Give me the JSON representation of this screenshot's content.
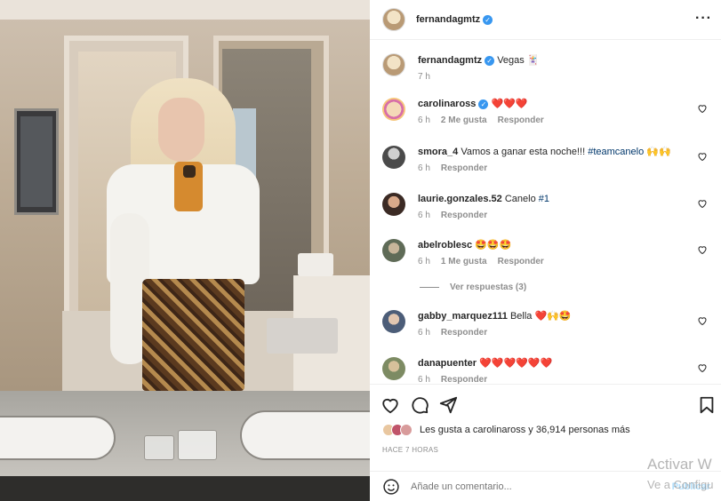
{
  "post": {
    "author": "fernandagmtz",
    "caption_user": "fernandagmtz",
    "caption_text": "Vegas 🃏",
    "caption_time": "7 h"
  },
  "comments": [
    {
      "user": "carolinaross",
      "verified": true,
      "text": "❤️❤️❤️",
      "time": "6 h",
      "likes": "2 Me gusta",
      "reply": "Responder",
      "avatar_color": "#e9c7a0"
    },
    {
      "user": "smora_4",
      "verified": false,
      "text": "Vamos a ganar esta noche!!!",
      "hashtag": "#teamcanelo",
      "suffix": " 🙌🙌",
      "time": "6 h",
      "likes": "",
      "reply": "Responder",
      "avatar_color": "#5c5c5c"
    },
    {
      "user": "laurie.gonzales.52",
      "verified": false,
      "text": "Canelo",
      "hashtag": "#1",
      "time": "6 h",
      "likes": "",
      "reply": "Responder",
      "avatar_color": "#7a4f3a"
    },
    {
      "user": "abelroblesc",
      "verified": false,
      "text": "🤩🤩🤩",
      "time": "6 h",
      "likes": "1 Me gusta",
      "reply": "Responder",
      "avatar_color": "#6d7a64"
    },
    {
      "user": "gabby_marquez111",
      "verified": false,
      "text": "Bella ❤️🙌🤩",
      "time": "6 h",
      "likes": "",
      "reply": "Responder",
      "avatar_color": "#5d6f88"
    },
    {
      "user": "danapuenter",
      "verified": false,
      "text": "❤️❤️❤️❤️❤️❤️",
      "time": "6 h",
      "likes": "",
      "reply": "Responder",
      "avatar_color": "#8f9a7c"
    }
  ],
  "view_replies": "Ver respuestas (3)",
  "likes_summary": "Les gusta a carolinaross y 36,914 personas más",
  "time_ago": "HACE 7 HORAS",
  "add_comment_placeholder": "Añade un comentario...",
  "publish_label": "Publicar",
  "watermark_line1": "Activar W",
  "watermark_line2": "Ve a Configu",
  "colors": {
    "verified": "#3897f0",
    "hashtag": "#00376b",
    "muted": "#8e8e8e"
  }
}
